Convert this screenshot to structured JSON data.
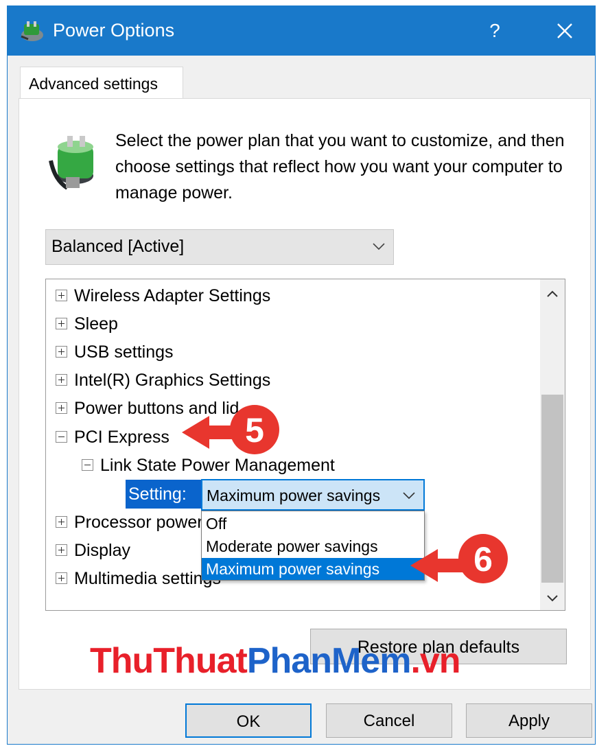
{
  "window": {
    "title": "Power Options",
    "help_label": "?",
    "close_icon": "close-icon"
  },
  "tab": {
    "label": "Advanced settings"
  },
  "description": "Select the power plan that you want to customize, and then choose settings that reflect how you want your computer to manage power.",
  "plan_select": {
    "value": "Balanced [Active]"
  },
  "tree": {
    "items": [
      {
        "label": "Wireless Adapter Settings",
        "expanded": false
      },
      {
        "label": "Sleep",
        "expanded": false
      },
      {
        "label": "USB settings",
        "expanded": false
      },
      {
        "label": "Intel(R) Graphics Settings",
        "expanded": false
      },
      {
        "label": "Power buttons and lid",
        "expanded": false
      },
      {
        "label": "PCI Express",
        "expanded": true
      },
      {
        "label": "Link State Power Management",
        "expanded": true
      },
      {
        "label": "Processor power management",
        "expanded": false
      },
      {
        "label": "Display",
        "expanded": false
      },
      {
        "label": "Multimedia settings",
        "expanded": false
      }
    ],
    "setting_label": "Setting:",
    "setting_value": "Maximum power savings",
    "options": [
      "Off",
      "Moderate power savings",
      "Maximum power savings"
    ],
    "selected_option_index": 2
  },
  "buttons": {
    "restore": "Restore plan defaults",
    "ok": "OK",
    "cancel": "Cancel",
    "apply": "Apply"
  },
  "callouts": {
    "step5": "5",
    "step6": "6"
  },
  "watermark": {
    "part1": "ThuThuat",
    "part2": "PhanMem",
    "part3": ".vn"
  },
  "colors": {
    "titlebar": "#1979ca",
    "selection": "#0078d7",
    "callout_red": "#e8362e",
    "watermark_red": "#e8202a",
    "watermark_blue": "#1e63c9"
  }
}
